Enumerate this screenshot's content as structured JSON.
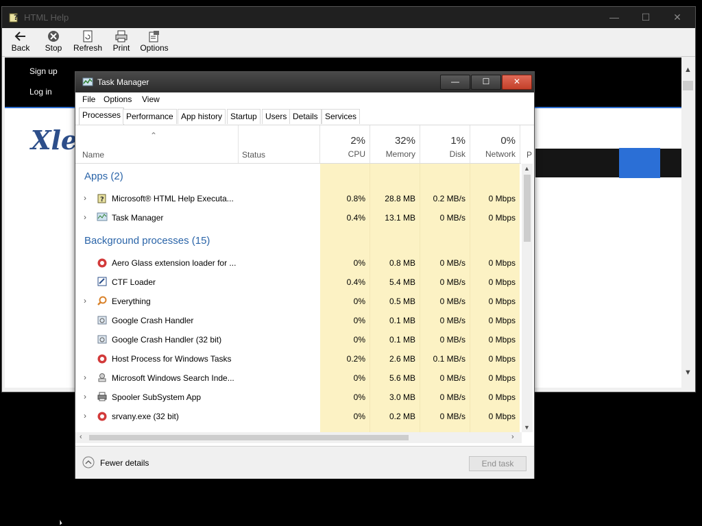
{
  "help_window": {
    "title": "HTML Help",
    "toolbar": [
      {
        "label": "Back",
        "icon": "back-arrow-icon"
      },
      {
        "label": "Stop",
        "icon": "stop-icon"
      },
      {
        "label": "Refresh",
        "icon": "refresh-icon"
      },
      {
        "label": "Print",
        "icon": "print-icon"
      },
      {
        "label": "Options",
        "icon": "options-icon"
      }
    ],
    "nav": {
      "sign_up": "Sign up",
      "log_in": "Log in"
    },
    "logo_text": "Xled"
  },
  "task_manager": {
    "title": "Task Manager",
    "menu": [
      "File",
      "Options",
      "View"
    ],
    "tabs": [
      "Processes",
      "Performance",
      "App history",
      "Startup",
      "Users",
      "Details",
      "Services"
    ],
    "active_tab": "Processes",
    "columns": {
      "name": "Name",
      "status": "Status",
      "cpu": {
        "pct": "2%",
        "label": "CPU"
      },
      "memory": {
        "pct": "32%",
        "label": "Memory"
      },
      "disk": {
        "pct": "1%",
        "label": "Disk"
      },
      "network": {
        "pct": "0%",
        "label": "Network"
      },
      "power": "P"
    },
    "groups": [
      {
        "label": "Apps (2)",
        "rows": [
          {
            "name": "Microsoft® HTML Help Executa...",
            "cpu": "0.8%",
            "memory": "28.8 MB",
            "disk": "0.2 MB/s",
            "network": "0 Mbps",
            "expandable": true,
            "icon": "html-help-icon"
          },
          {
            "name": "Task Manager",
            "cpu": "0.4%",
            "memory": "13.1 MB",
            "disk": "0 MB/s",
            "network": "0 Mbps",
            "expandable": true,
            "icon": "task-manager-icon"
          }
        ]
      },
      {
        "label": "Background processes (15)",
        "rows": [
          {
            "name": "Aero Glass extension loader for ...",
            "cpu": "0%",
            "memory": "0.8 MB",
            "disk": "0 MB/s",
            "network": "0 Mbps",
            "expandable": false,
            "icon": "app-red-icon"
          },
          {
            "name": "CTF Loader",
            "cpu": "0.4%",
            "memory": "5.4 MB",
            "disk": "0 MB/s",
            "network": "0 Mbps",
            "expandable": false,
            "icon": "ctf-loader-icon"
          },
          {
            "name": "Everything",
            "cpu": "0%",
            "memory": "0.5 MB",
            "disk": "0 MB/s",
            "network": "0 Mbps",
            "expandable": true,
            "icon": "search-icon"
          },
          {
            "name": "Google Crash Handler",
            "cpu": "0%",
            "memory": "0.1 MB",
            "disk": "0 MB/s",
            "network": "0 Mbps",
            "expandable": false,
            "icon": "crash-handler-icon"
          },
          {
            "name": "Google Crash Handler (32 bit)",
            "cpu": "0%",
            "memory": "0.1 MB",
            "disk": "0 MB/s",
            "network": "0 Mbps",
            "expandable": false,
            "icon": "crash-handler-icon"
          },
          {
            "name": "Host Process for Windows Tasks",
            "cpu": "0.2%",
            "memory": "2.6 MB",
            "disk": "0.1 MB/s",
            "network": "0 Mbps",
            "expandable": false,
            "icon": "app-red-icon"
          },
          {
            "name": "Microsoft Windows Search Inde...",
            "cpu": "0%",
            "memory": "5.6 MB",
            "disk": "0 MB/s",
            "network": "0 Mbps",
            "expandable": true,
            "icon": "search-indexer-icon"
          },
          {
            "name": "Spooler SubSystem App",
            "cpu": "0%",
            "memory": "3.0 MB",
            "disk": "0 MB/s",
            "network": "0 Mbps",
            "expandable": true,
            "icon": "printer-icon"
          },
          {
            "name": "srvany.exe (32 bit)",
            "cpu": "0%",
            "memory": "0.2 MB",
            "disk": "0 MB/s",
            "network": "0 Mbps",
            "expandable": true,
            "icon": "app-red-icon"
          }
        ]
      }
    ],
    "fewer_details": "Fewer details",
    "end_task": "End task"
  }
}
